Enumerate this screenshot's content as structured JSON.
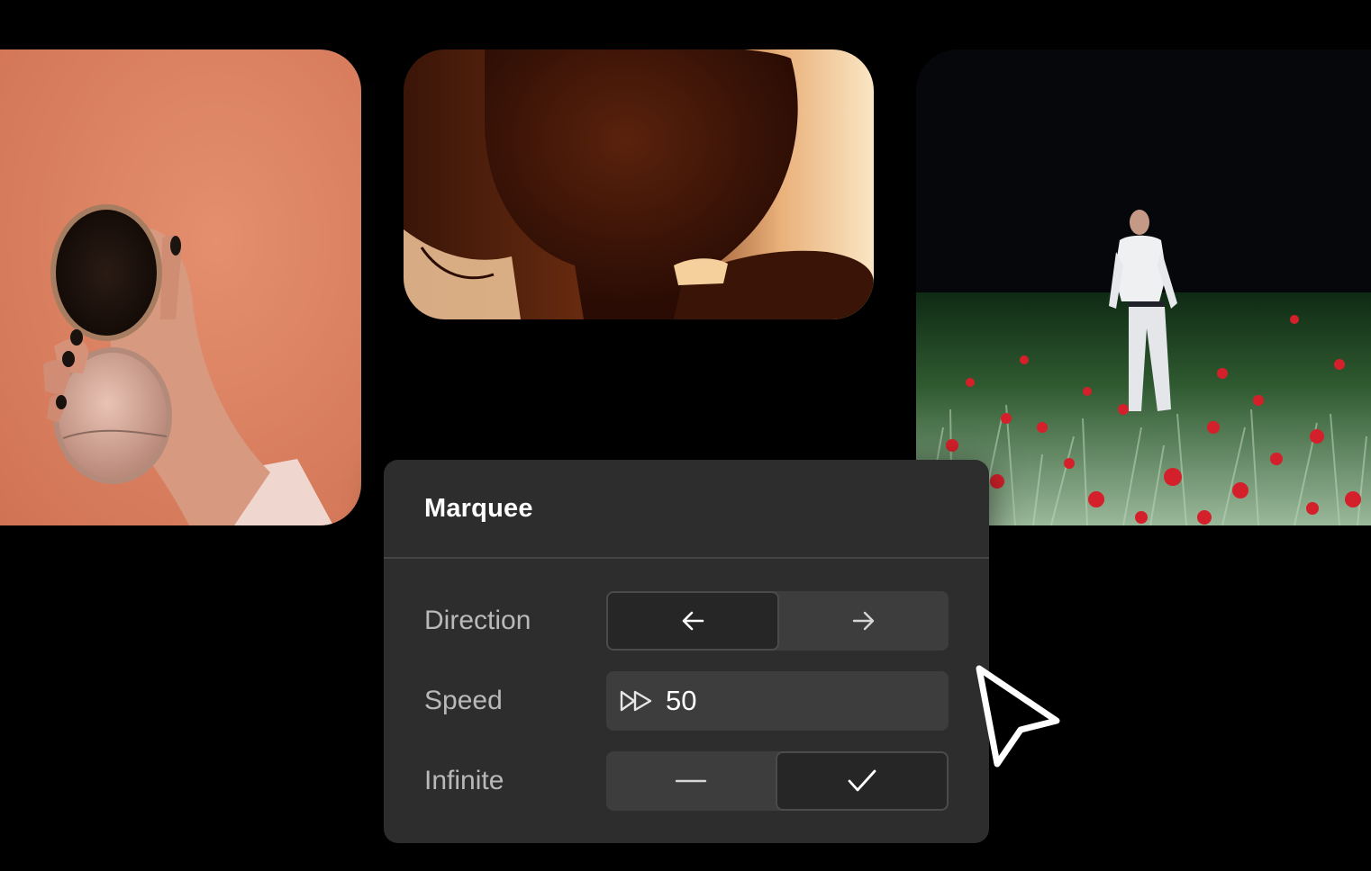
{
  "panel": {
    "title": "Marquee"
  },
  "controls": {
    "direction": {
      "label": "Direction",
      "options": [
        "arrow-left-icon",
        "arrow-right-icon"
      ],
      "selected": "left"
    },
    "speed": {
      "label": "Speed",
      "icon": "fast-forward-icon",
      "value": "50"
    },
    "infinite": {
      "label": "Infinite",
      "options": [
        "dash-icon",
        "check-icon"
      ],
      "selected": "check"
    }
  },
  "colors": {
    "background": "#000000",
    "panel": "#2d2d2d",
    "control": "#3d3d3d",
    "control_active": "#262626",
    "label": "#b9b9b9",
    "title": "#ffffff"
  },
  "images": [
    {
      "name": "photo-hand-mirror",
      "subject": "hand holding compact mirror against peach wall"
    },
    {
      "name": "photo-backlit-silhouette",
      "subject": "backlit silhouette of head and shoulder"
    },
    {
      "name": "photo-man-in-field",
      "subject": "man in white standing in field of red poppies at night"
    }
  ],
  "cursor": "pointer-cursor-icon"
}
